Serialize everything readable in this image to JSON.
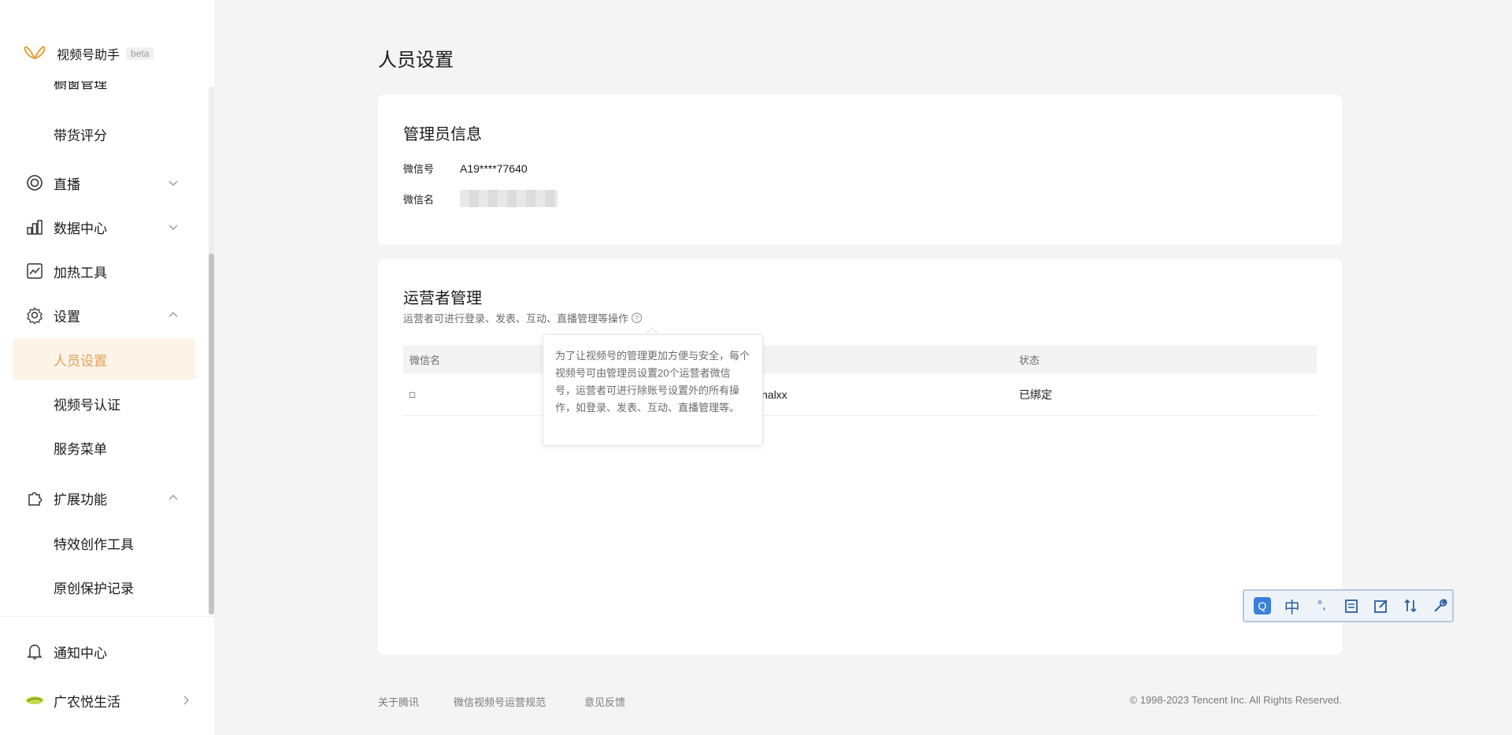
{
  "brand": {
    "name": "视频号助手",
    "badge": "beta"
  },
  "sidebar": {
    "partial_item": "橱窗管理",
    "items": [
      {
        "label": "带货评分"
      },
      {
        "label": "直播"
      },
      {
        "label": "数据中心"
      },
      {
        "label": "加热工具"
      },
      {
        "label": "设置"
      },
      {
        "label": "人员设置"
      },
      {
        "label": "视频号认证"
      },
      {
        "label": "服务菜单"
      },
      {
        "label": "扩展功能"
      },
      {
        "label": "特效创作工具"
      },
      {
        "label": "原创保护记录"
      }
    ],
    "bottom": [
      {
        "label": "通知中心"
      },
      {
        "label": "广农悦生活"
      }
    ]
  },
  "page": {
    "title": "人员设置"
  },
  "admin": {
    "title": "管理员信息",
    "wechat_id_label": "微信号",
    "wechat_id": "A19****77640",
    "wechat_name_label": "微信名"
  },
  "operators": {
    "title": "运营者管理",
    "description": "运营者可进行登录、发表、互动、直播管理等操作",
    "help": "?",
    "columns": [
      "微信名",
      "",
      "状态"
    ],
    "rows": [
      {
        "name": "□",
        "id": "nalxx",
        "status": "已绑定"
      }
    ],
    "tooltip": "为了让视频号的管理更加方便与安全，每个视频号可由管理员设置20个运营者微信号，运营者可进行除账号设置外的所有操作，如登录、发表、互动、直播管理等。"
  },
  "footer": {
    "links": [
      "关于腾讯",
      "微信视频号运营规范",
      "意见反馈"
    ],
    "copyright": "© 1998-2023 Tencent Inc. All Rights Reserved."
  },
  "ime": {
    "mode": "中",
    "punct": "°,",
    "q": "Q"
  },
  "colors": {
    "accent": "#e0a357",
    "active_bg": "#fdf3e7",
    "page_bg": "#f4f4f4"
  }
}
